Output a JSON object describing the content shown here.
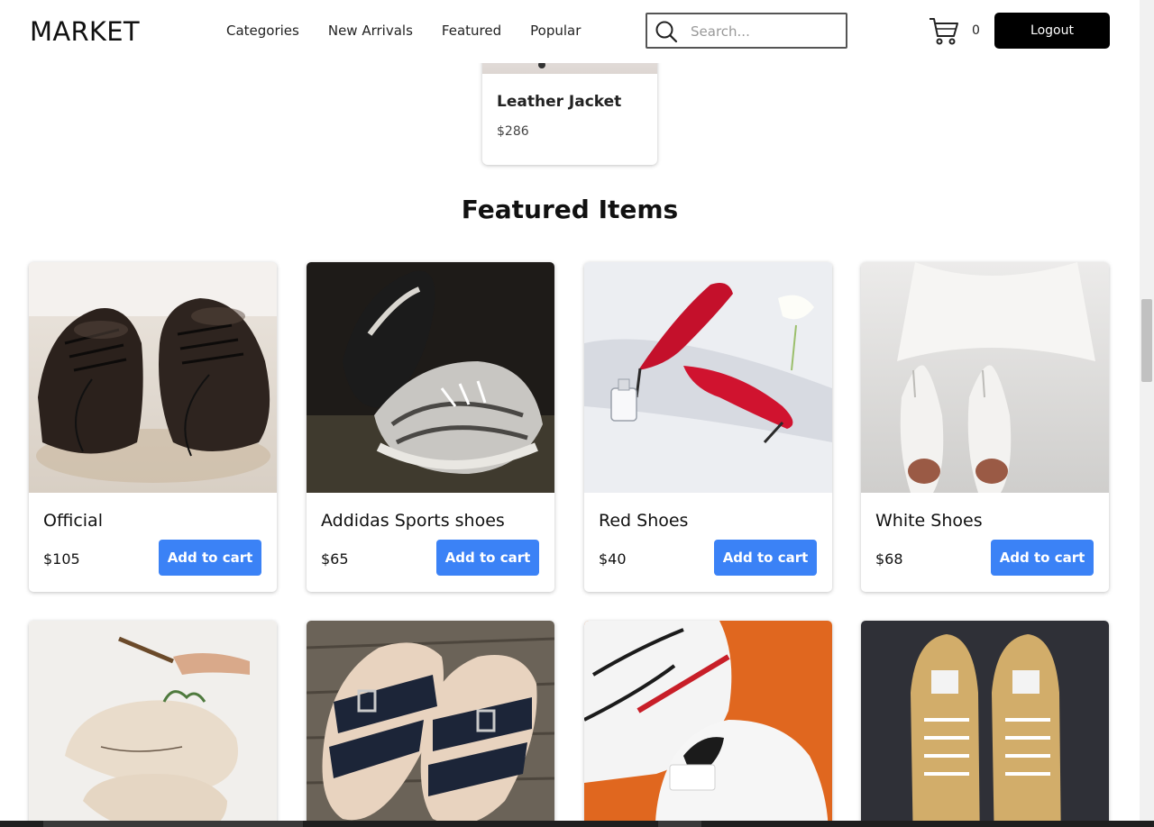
{
  "header": {
    "logo": "MARKET",
    "nav": [
      "Categories",
      "New Arrivals",
      "Featured",
      "Popular"
    ],
    "search_placeholder": "Search...",
    "cart_count": "0",
    "logout_label": "Logout"
  },
  "previous_item": {
    "name": "Leather Jacket",
    "price": "$286"
  },
  "featured": {
    "title": "Featured Items",
    "add_label": "Add to cart",
    "items": [
      {
        "name": "Official",
        "price": "$105",
        "image": "black-leather-dress-shoes"
      },
      {
        "name": "Addidas Sports shoes",
        "price": "$65",
        "image": "black-white-knit-sneakers"
      },
      {
        "name": "Red Shoes",
        "price": "$40",
        "image": "red-high-heels"
      },
      {
        "name": "White Shoes",
        "price": "$68",
        "image": "white-bridal-pumps"
      }
    ],
    "more_items": [
      {
        "image": "painted-canvas-sneakers"
      },
      {
        "image": "navy-buckle-sandals"
      },
      {
        "image": "white-nike-air-sneakers"
      },
      {
        "image": "tan-vans-sneakers"
      }
    ]
  },
  "colors": {
    "accent": "#3b82f6",
    "logout_bg": "#000000"
  }
}
